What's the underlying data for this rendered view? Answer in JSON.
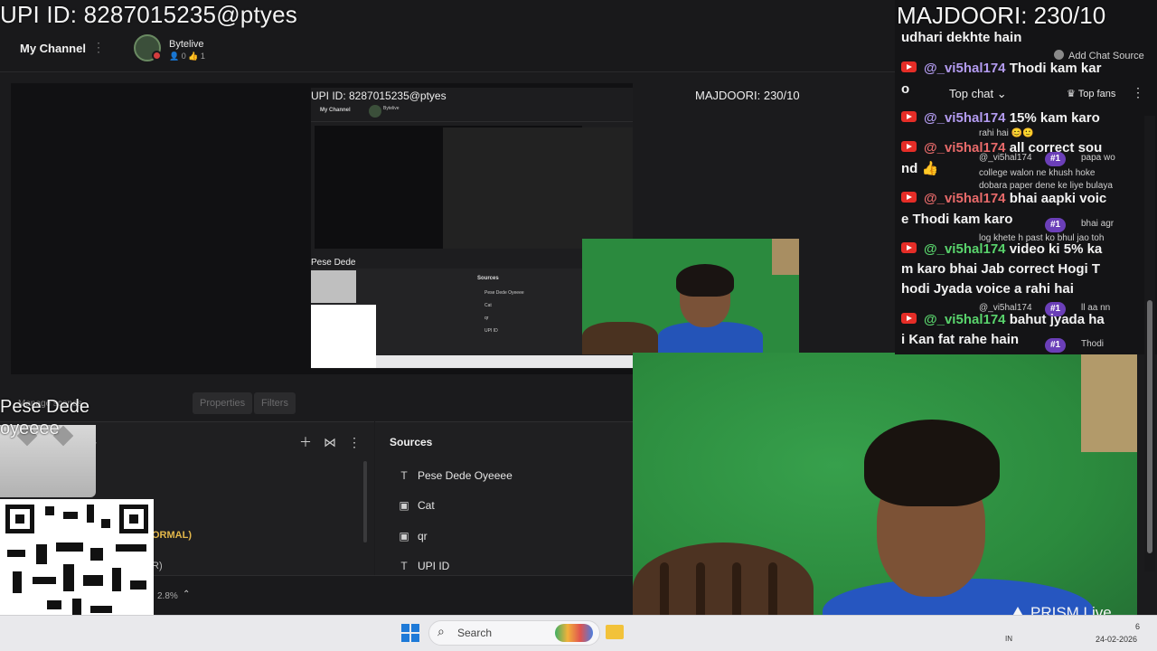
{
  "overlay": {
    "upi_text": "UPI ID: 8287015235@ptyes",
    "majdoori_text": "MAJDOORI: 230/10",
    "pese_line1": "Pese Dede",
    "pese_line2": "oyeeee"
  },
  "header": {
    "channel_label": "My Channel",
    "channel_name": "Bytelive",
    "channel_stats": "👤 0 👍 1"
  },
  "preview": {
    "upi_text": "UPI ID: 8287015235@ptyes",
    "majdoori_text": "MAJDOORI: 230/10",
    "my_channel": "My Channel",
    "channel_name": "Bytelive",
    "pese_text": "Pese Dede",
    "sources_title": "Sources",
    "sources": [
      "Pese Dede Oyeeee",
      "Cat",
      "qr",
      "UPI ID"
    ]
  },
  "tabs": {
    "scenes_label": "Manage scenes",
    "properties": "Properties",
    "filters": "Filters"
  },
  "scenes_panel": {
    "dropdown_label": "led",
    "normal_text": "ORMAL)",
    "r_text": "R)"
  },
  "sources_panel": {
    "title": "Sources",
    "items": [
      {
        "icon": "text-icon",
        "glyph": "T",
        "label": "Pese Dede Oyeeee"
      },
      {
        "icon": "image-icon",
        "glyph": "▣",
        "label": "Cat"
      },
      {
        "icon": "image-icon",
        "glyph": "▣",
        "label": "qr"
      },
      {
        "icon": "text-icon",
        "glyph": "T",
        "label": "UPI ID"
      }
    ]
  },
  "status": {
    "zoom": "2.8%"
  },
  "taskbar": {
    "search_label": "Search",
    "tray_lang": "IN",
    "tray_time": "6",
    "tray_date": "24-02-2026"
  },
  "branding": {
    "prism": "PRISM Live"
  },
  "chat": {
    "add_chat_source": "Add Chat Source",
    "top_chat": "Top chat",
    "top_fans": "Top fans",
    "lines": [
      {
        "text": "udhari dekhte hain"
      },
      {
        "user": "@_vi5hal174",
        "msg": "Thodi kam kar"
      },
      {
        "text": "o"
      },
      {
        "user": "@_vi5hal174",
        "msg": "15% kam karo"
      },
      {
        "user": "@_vi5hal174",
        "msg": "all correct sou"
      },
      {
        "text": "nd 👍"
      },
      {
        "user": "@_vi5hal174",
        "msg": "bhai aapki voic"
      },
      {
        "text": "e Thodi kam karo"
      },
      {
        "user": "@_vi5hal174",
        "msg": "video ki 5% ka"
      },
      {
        "text": "m karo bhai Jab correct Hogi T"
      },
      {
        "text": "hodi Jyada voice a rahi hai"
      },
      {
        "user": "@_vi5hal174",
        "msg": "bahut jyada ha"
      },
      {
        "text": "i Kan fat rahe hain"
      }
    ],
    "fan_rows": [
      {
        "name": "@_vi5hal174",
        "badge": "#1",
        "msg": "papa wo"
      },
      {
        "name": "",
        "badge": "",
        "msg": "college walon ne khush hoke"
      },
      {
        "name": "",
        "badge": "",
        "msg": "dobara paper dene ke liye bulaya"
      },
      {
        "name": "",
        "badge": "#1",
        "msg": "bhai agr"
      },
      {
        "name": "",
        "badge": "",
        "msg": "log khete h past ko bhul jao toh"
      },
      {
        "name": "@_vi5hal174",
        "badge": "#1",
        "msg": "ll aa nn"
      },
      {
        "name": "@_vi5hal174",
        "badge": "#1",
        "msg": "Thodi"
      }
    ],
    "small_texts": {
      "rahi_hai": "rahi hai 😊🙂"
    }
  },
  "colors": {
    "green_screen": "#2f8f42",
    "shirt": "#2656c0",
    "username_green": "#59d36c",
    "badge_purple": "#6b3fb8",
    "youtube_red": "#e52d27"
  }
}
